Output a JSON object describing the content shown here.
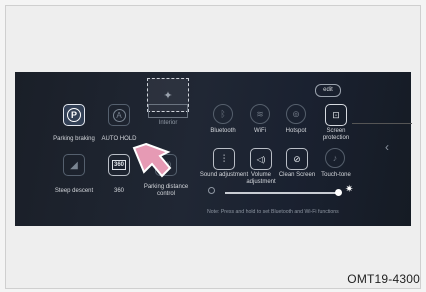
{
  "header": {
    "edit_label": "edit"
  },
  "left_panel": {
    "items": [
      {
        "label": "Parking braking",
        "icon": "parking-brake-icon",
        "glyph": "P"
      },
      {
        "label": "AUTO HOLD",
        "icon": "auto-hold-icon",
        "glyph": "A"
      },
      {
        "label": "Steep descent",
        "icon": "hill-descent-icon",
        "glyph": "◢"
      },
      {
        "label": "360",
        "icon": "camera-360-icon",
        "glyph": "360"
      },
      {
        "label": "Parking distance control",
        "icon": "parking-distance-icon",
        "glyph": "((·))"
      }
    ]
  },
  "drag_ghost": {
    "label": "Interior"
  },
  "right_panel": {
    "row1": [
      {
        "label": "Bluetooth",
        "icon": "bluetooth-icon",
        "glyph": "ᛒ"
      },
      {
        "label": "WiFi",
        "icon": "wifi-icon",
        "glyph": "≋"
      },
      {
        "label": "Hotspot",
        "icon": "hotspot-icon",
        "glyph": "⊚"
      },
      {
        "label": "Screen protection",
        "icon": "screen-protection-icon",
        "glyph": "⊡"
      }
    ],
    "row2": [
      {
        "label": "Sound adjustment",
        "icon": "equalizer-icon",
        "glyph": "⫶"
      },
      {
        "label": "Volume adjustment",
        "icon": "speaker-icon",
        "glyph": "◁)"
      },
      {
        "label": "Clean Screen",
        "icon": "clean-screen-icon",
        "glyph": "⊘"
      },
      {
        "label": "Touch-tone",
        "icon": "touch-tone-icon",
        "glyph": "♪"
      }
    ]
  },
  "brightness": {
    "level": 0.9
  },
  "note": "Note: Press and hold to set Bluetooth and Wi-Fi functions",
  "figure_code": "OMT19-4300"
}
